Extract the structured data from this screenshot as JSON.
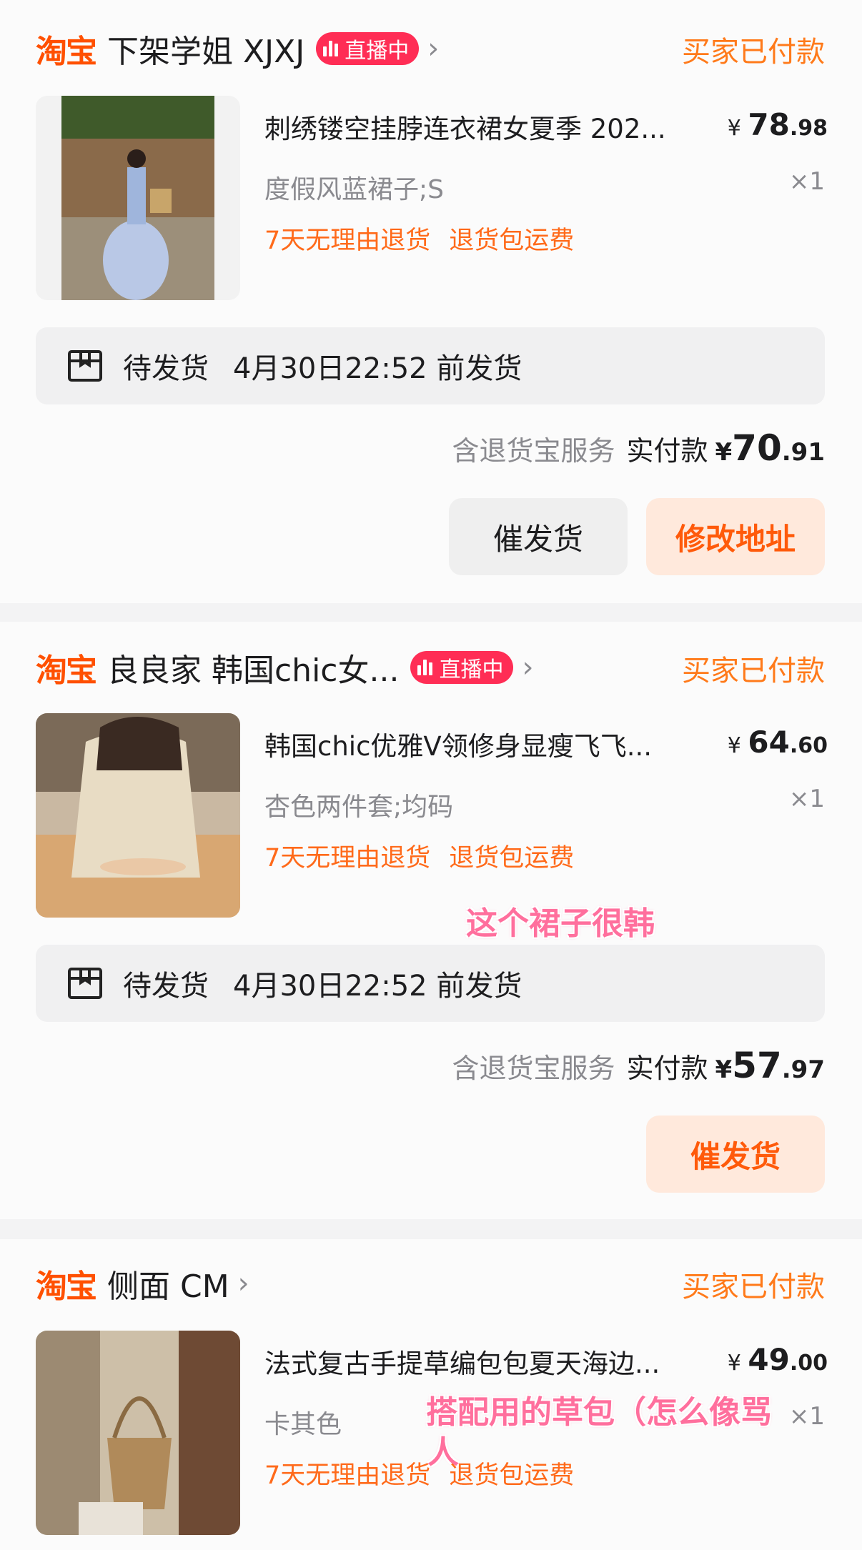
{
  "orders": [
    {
      "logo": "淘宝",
      "shop": "下架学姐 XJXJ",
      "live": "直播中",
      "status": "买家已付款",
      "item_title": "刺绣镂空挂脖连衣裙女夏季 202...",
      "price_cur": "¥",
      "price_int": "78",
      "price_dec": ".98",
      "sku": "度假风蓝裙子;S",
      "qty": "×1",
      "tag1": "7天无理由退货",
      "tag2": "退货包运费",
      "ship_status": "待发货",
      "ship_time": "4月30日22:52 前发货",
      "pay_note": "含退货宝服务",
      "pay_label": "实付款",
      "pay_cur": "¥",
      "pay_int": "70",
      "pay_dec": ".91",
      "btn1": "催发货",
      "btn2": "修改地址"
    },
    {
      "logo": "淘宝",
      "shop": "良良家 韩国chic女...",
      "live": "直播中",
      "status": "买家已付款",
      "item_title": "韩国chic优雅V领修身显瘦飞飞...",
      "price_cur": "¥",
      "price_int": "64",
      "price_dec": ".60",
      "sku": "杏色两件套;均码",
      "qty": "×1",
      "tag1": "7天无理由退货",
      "tag2": "退货包运费",
      "annotation": "这个裙子很韩",
      "ship_status": "待发货",
      "ship_time": "4月30日22:52 前发货",
      "pay_note": "含退货宝服务",
      "pay_label": "实付款",
      "pay_cur": "¥",
      "pay_int": "57",
      "pay_dec": ".97",
      "btn1": "催发货"
    },
    {
      "logo": "淘宝",
      "shop": "侧面 CM",
      "status": "买家已付款",
      "item_title": "法式复古手提草编包包夏天海边...",
      "price_cur": "¥",
      "price_int": "49",
      "price_dec": ".00",
      "sku": "卡其色",
      "qty": "×1",
      "tag1": "7天无理由退货",
      "tag2": "退货包运费",
      "annotation_line1": "搭配用的草包（怎么像骂",
      "annotation_line2": "人"
    }
  ],
  "colors": {
    "brand": "#ff5000",
    "status": "#ff7a1a",
    "live": "#ff2d55",
    "annotation": "#ff6f9d"
  }
}
